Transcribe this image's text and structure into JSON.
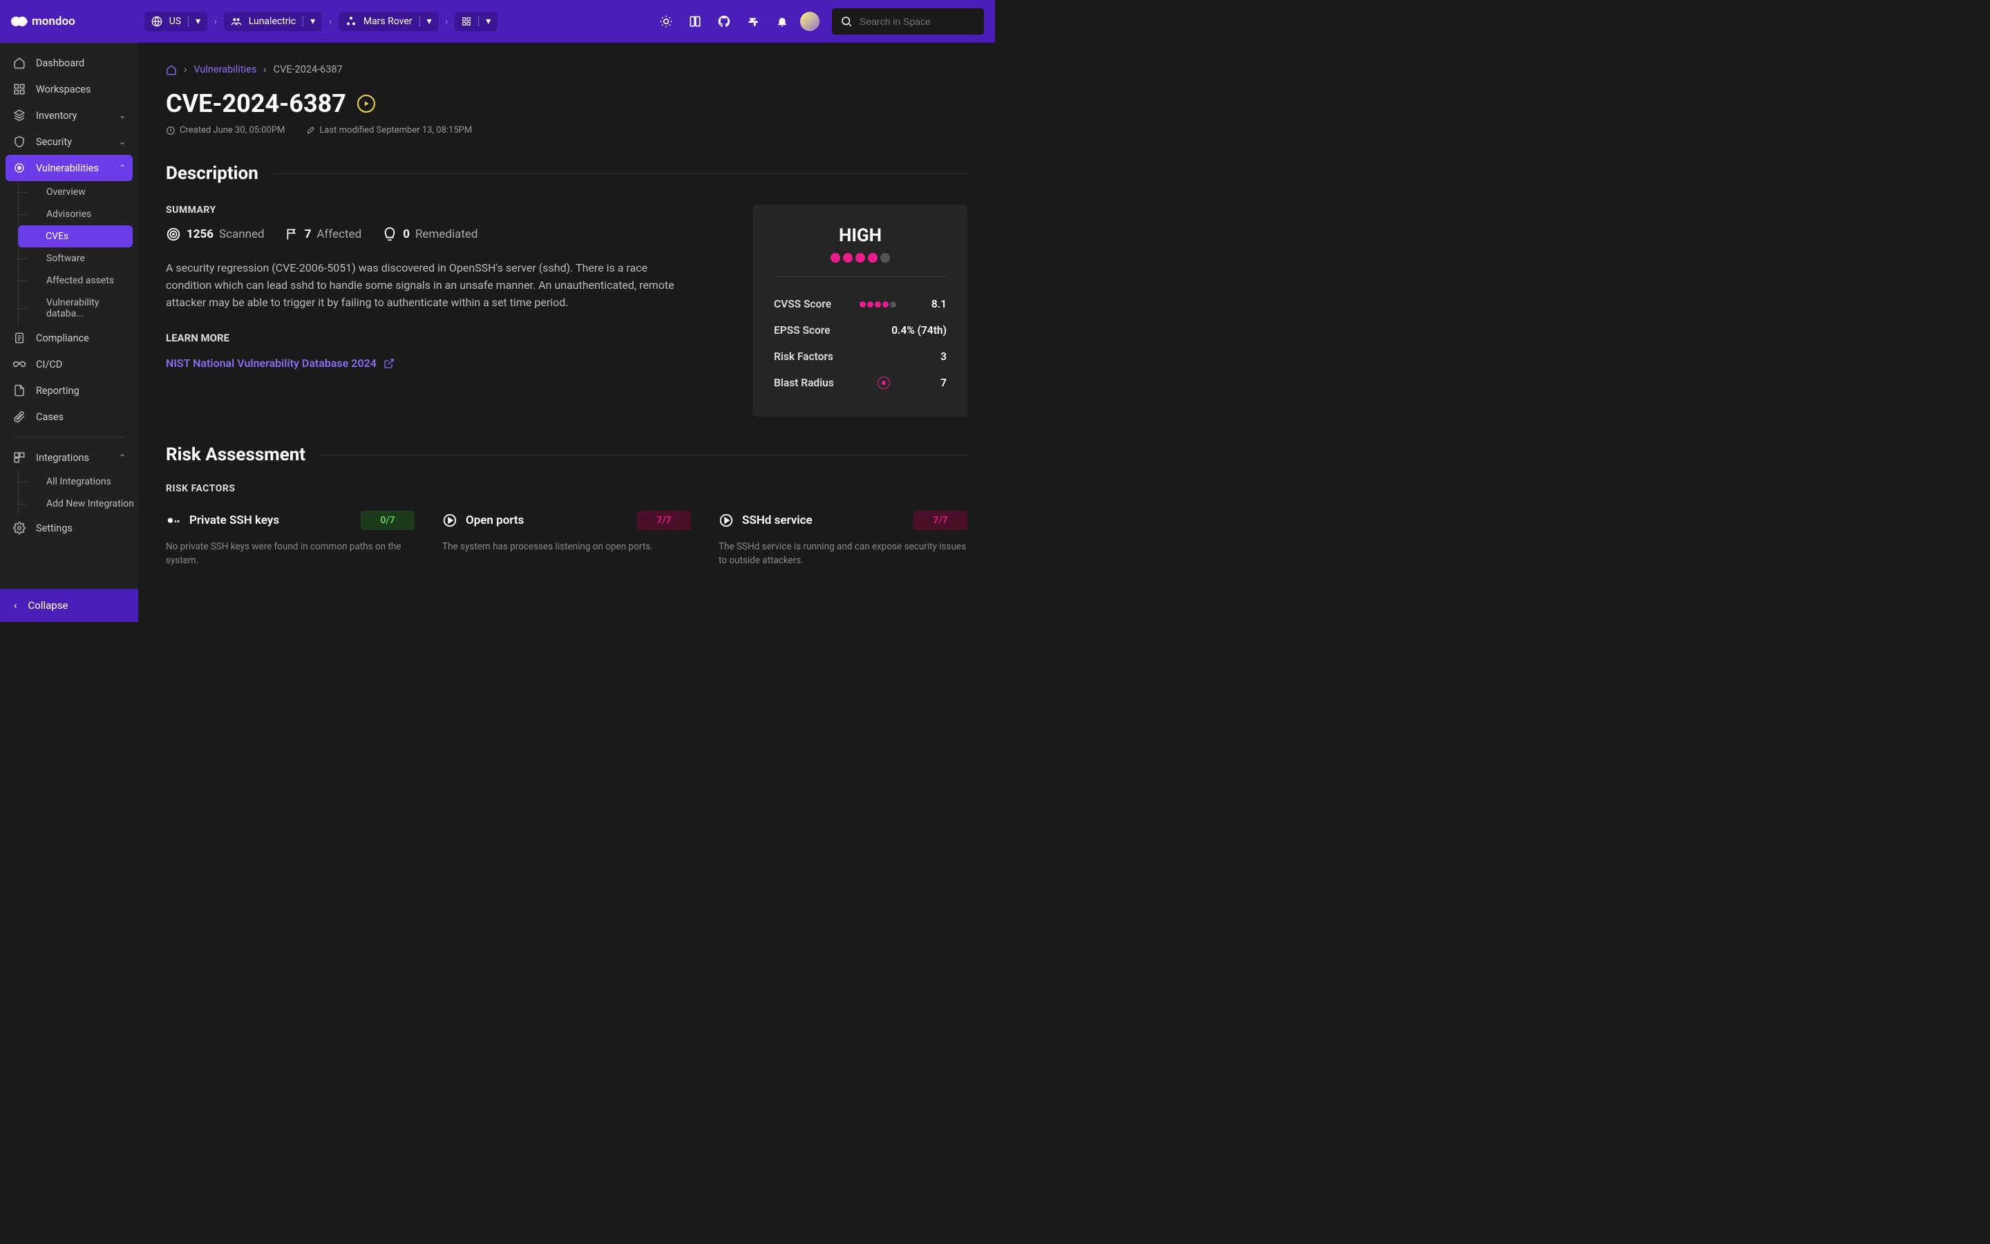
{
  "brand": "mondoo",
  "header": {
    "region": "US",
    "org": "Lunalectric",
    "space": "Mars Rover",
    "search_placeholder": "Search in Space"
  },
  "sidebar": {
    "items": {
      "dashboard": "Dashboard",
      "workspaces": "Workspaces",
      "inventory": "Inventory",
      "security": "Security",
      "vulnerabilities": "Vulnerabilities",
      "compliance": "Compliance",
      "cicd": "CI/CD",
      "reporting": "Reporting",
      "cases": "Cases",
      "integrations": "Integrations",
      "settings": "Settings"
    },
    "vuln_sub": {
      "overview": "Overview",
      "advisories": "Advisories",
      "cves": "CVEs",
      "software": "Software",
      "affected": "Affected assets",
      "database": "Vulnerability databa..."
    },
    "integrations_sub": {
      "all": "All Integrations",
      "add": "Add New Integration"
    },
    "collapse": "Collapse"
  },
  "breadcrumbs": {
    "l1": "Vulnerabilities",
    "l2": "CVE-2024-6387"
  },
  "page": {
    "title": "CVE-2024-6387",
    "created": "Created June 30, 05:00PM",
    "modified": "Last modified September 13, 08:15PM"
  },
  "sections": {
    "description": "Description",
    "summary": "SUMMARY",
    "learn_more": "LEARN MORE",
    "risk_assessment": "Risk Assessment",
    "risk_factors": "RISK FACTORS"
  },
  "summary": {
    "scanned": "1256",
    "scanned_label": "Scanned",
    "affected": "7",
    "affected_label": "Affected",
    "remediated": "0",
    "remediated_label": "Remediated",
    "body": "A security regression (CVE-2006-5051) was discovered in OpenSSH's server (sshd). There is a race condition which can lead sshd to handle some signals in an unsafe manner. An unauthenticated, remote attacker may be able to trigger it by failing to authenticate within a set time period.",
    "link": "NIST National Vulnerability Database 2024"
  },
  "score": {
    "severity": "HIGH",
    "cvss_label": "CVSS Score",
    "cvss_value": "8.1",
    "epss_label": "EPSS Score",
    "epss_value": "0.4% (74th)",
    "risk_factors_label": "Risk Factors",
    "risk_factors_value": "3",
    "blast_label": "Blast Radius",
    "blast_value": "7"
  },
  "risk_factors": [
    {
      "title": "Private SSH keys",
      "badge": "0/7",
      "badge_kind": "green",
      "desc": "No private SSH keys were found in common paths on the system."
    },
    {
      "title": "Open ports",
      "badge": "7/7",
      "badge_kind": "red",
      "desc": "The system has processes listening on open ports."
    },
    {
      "title": "SSHd service",
      "badge": "7/7",
      "badge_kind": "red",
      "desc": "The SSHd service is running and can expose security issues to outside attackers."
    }
  ]
}
